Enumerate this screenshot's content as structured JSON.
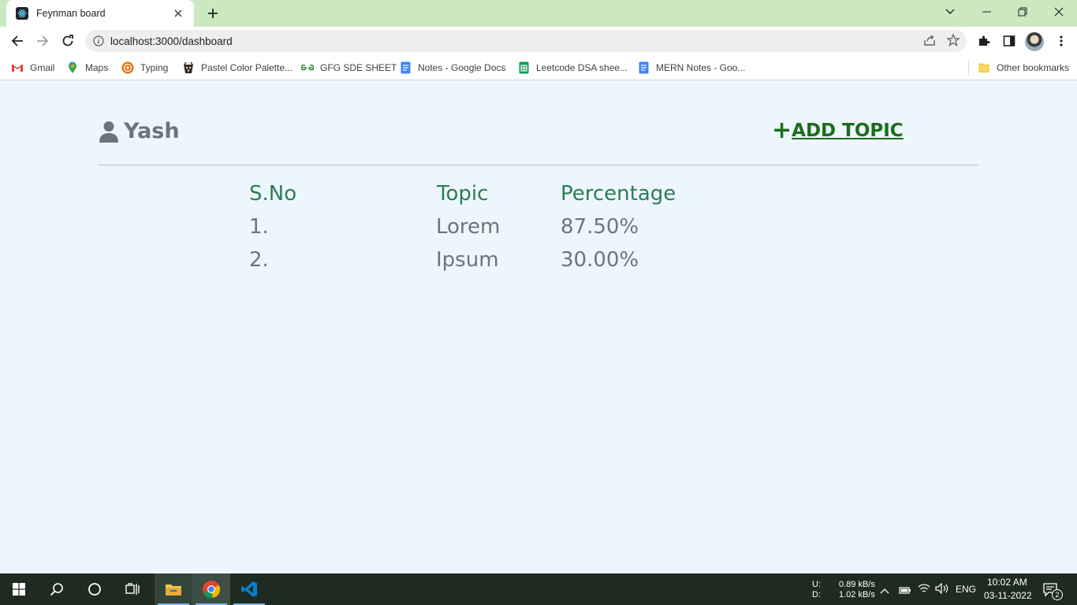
{
  "browser": {
    "tab_title": "Feynman board",
    "url": "localhost:3000/dashboard",
    "bookmarks": [
      {
        "label": "Gmail",
        "icon": "gmail-icon"
      },
      {
        "label": "Maps",
        "icon": "maps-icon"
      },
      {
        "label": "Typing",
        "icon": "typing-icon"
      },
      {
        "label": "Pastel Color Palette...",
        "icon": "palette-icon"
      },
      {
        "label": "GFG SDE SHEET",
        "icon": "gfg-icon"
      },
      {
        "label": "Notes - Google Docs",
        "icon": "docs-icon"
      },
      {
        "label": "Leetcode DSA shee...",
        "icon": "sheets-icon"
      },
      {
        "label": "MERN Notes - Goo...",
        "icon": "docs-icon"
      }
    ],
    "other_bookmarks": "Other bookmarks"
  },
  "page": {
    "user_name": "Yash",
    "add_plus": "+",
    "add_label": "ADD TOPIC",
    "table": {
      "headers": [
        "S.No",
        "Topic",
        "Percentage"
      ],
      "rows": [
        [
          "1.",
          "Lorem",
          "87.50%"
        ],
        [
          "2.",
          "Ipsum",
          "30.00%"
        ]
      ]
    }
  },
  "taskbar": {
    "net_up_label": "U:",
    "net_down_label": "D:",
    "net_up": "0.89 kB/s",
    "net_down": "1.02 kB/s",
    "language": "ENG",
    "time": "10:02 AM",
    "date": "03-11-2022",
    "notifications": "2"
  },
  "colors": {
    "tabstrip": "#cce8c0",
    "page_bg": "#eef6fd",
    "header_green": "#2b7d55",
    "add_green": "#1a6e1a",
    "cell_gray": "#6d7380"
  }
}
